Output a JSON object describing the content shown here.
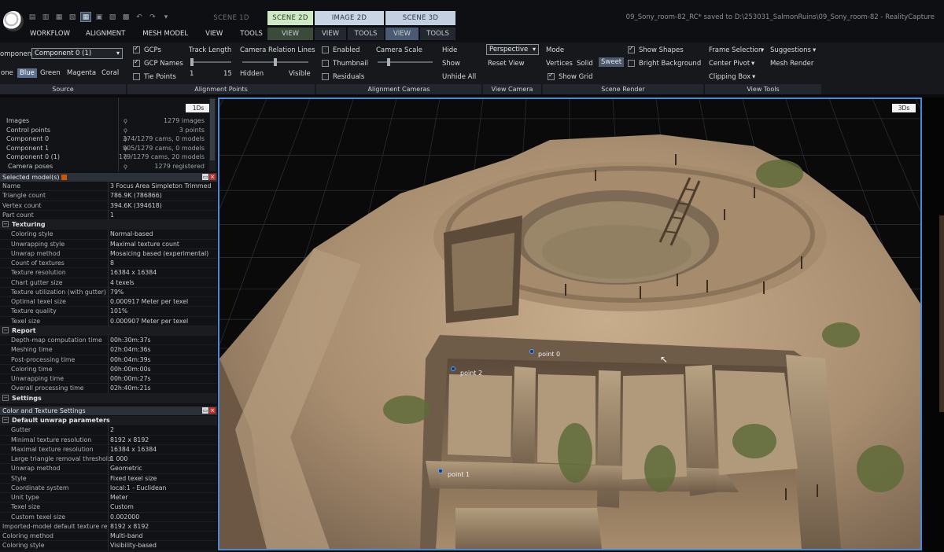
{
  "title_bar": {
    "scene_tabs": [
      "SCENE 1D",
      "SCENE 2D",
      "IMAGE 2D",
      "SCENE 3D"
    ],
    "sub_tabs": {
      "scene2d_view": "VIEW",
      "image_view": "VIEW",
      "image_tools": "TOOLS",
      "scene3d_view": "VIEW",
      "scene3d_tools": "TOOLS"
    },
    "menu": [
      "WORKFLOW",
      "ALIGNMENT",
      "MESH MODEL",
      "VIEW",
      "TOOLS"
    ],
    "status": "09_Sony_room-82_RC* saved to D:\\253031_SalmonRuins\\09_Sony_room-82 - RealityCapture"
  },
  "ribbon": {
    "source": {
      "component_label": "omponent",
      "component_value": "Component 0 (1)",
      "colors": [
        "one",
        "Blue",
        "Green",
        "Magenta",
        "Coral"
      ],
      "selected_color": "Blue",
      "group_label": "Source"
    },
    "alignment_points": {
      "gcps": "GCPs",
      "gcp_names": "GCP Names",
      "tie_points": "Tie Points",
      "track_length": "Track Length",
      "track_min": "1",
      "track_max": "15",
      "camera_relation_lines": "Camera Relation Lines",
      "hidden": "Hidden",
      "visible": "Visible",
      "group_label": "Alignment Points"
    },
    "alignment_cameras": {
      "enabled": "Enabled",
      "thumbnail": "Thumbnail",
      "residuals": "Residuals",
      "camera_scale": "Camera Scale",
      "hide": "Hide",
      "show": "Show",
      "unhide_all": "Unhide All",
      "group_label": "Alignment Cameras"
    },
    "view_camera": {
      "projection": "Perspective",
      "reset_view": "Reset View",
      "group_label": "View Camera"
    },
    "scene_render": {
      "mode": "Mode",
      "vertices": "Vertices",
      "solid": "Solid",
      "sweet": "Sweet",
      "show_shapes": "Show Shapes",
      "bright_background": "Bright Background",
      "show_grid": "Show Grid",
      "group_label": "Scene Render"
    },
    "view_tools": {
      "frame_selection": "Frame Selection",
      "suggestions": "Suggestions",
      "center_pivot": "Center Pivot",
      "mesh_render": "Mesh Render",
      "clipping_box": "Clipping Box",
      "group_label": "View Tools"
    }
  },
  "project_tree": {
    "tag": "1Ds",
    "rows": [
      {
        "name": "Images",
        "value": "1279 images"
      },
      {
        "name": "Control points",
        "value": "3 points"
      },
      {
        "name": "Component 0",
        "value": "374/1279 cams, 0 models"
      },
      {
        "name": "Component 1",
        "value": "905/1279 cams, 0 models"
      },
      {
        "name": "Component 0 (1)",
        "value": "179/1279 cams, 20 models"
      },
      {
        "name": "Camera poses",
        "value": "1279 registered"
      }
    ]
  },
  "selected_models": {
    "title": "Selected model(s)",
    "rows": [
      {
        "k": "Name",
        "v": "3 Focus Area Simpleton Trimmed"
      },
      {
        "k": "Triangle count",
        "v": "786.9K (786866)"
      },
      {
        "k": "Vertex count",
        "v": "394.6K (394618)"
      },
      {
        "k": "Part count",
        "v": "1"
      }
    ],
    "texturing_label": "Texturing",
    "texturing": [
      {
        "k": "Coloring style",
        "v": "Normal-based"
      },
      {
        "k": "Unwrapping style",
        "v": "Maximal texture count"
      },
      {
        "k": "Unwrap method",
        "v": "Mosaicing based (experimental)"
      },
      {
        "k": "Count of textures",
        "v": "8"
      },
      {
        "k": "Texture resolution",
        "v": "16384 x 16384"
      },
      {
        "k": "Chart gutter size",
        "v": "4 texels"
      },
      {
        "k": "Texture utilization (with gutter)",
        "v": "79%"
      },
      {
        "k": "Optimal texel size",
        "v": "0.000917 Meter per texel"
      },
      {
        "k": "Texture quality",
        "v": "101%"
      },
      {
        "k": "Texel size",
        "v": "0.000907 Meter per texel"
      }
    ],
    "report_label": "Report",
    "report": [
      {
        "k": "Depth-map computation time",
        "v": "00h:30m:37s"
      },
      {
        "k": "Meshing time",
        "v": "02h:04m:36s"
      },
      {
        "k": "Post-processing time",
        "v": "00h:04m:39s"
      },
      {
        "k": "Coloring time",
        "v": "00h:00m:00s"
      },
      {
        "k": "Unwrapping time",
        "v": "00h:00m:27s"
      },
      {
        "k": "Overall processing time",
        "v": "02h:40m:21s"
      }
    ],
    "settings_label": "Settings"
  },
  "color_texture_settings": {
    "title": "Color and Texture Settings",
    "section_label": "Default unwrap parameters",
    "rows": [
      {
        "k": "Gutter",
        "v": "2"
      },
      {
        "k": "Minimal texture resolution",
        "v": "8192 x 8192"
      },
      {
        "k": "Maximal texture resolution",
        "v": "16384 x 16384"
      },
      {
        "k": "Large triangle removal threshold",
        "v": "1 000"
      },
      {
        "k": "Unwrap method",
        "v": "Geometric"
      },
      {
        "k": "Style",
        "v": "Fixed texel size"
      },
      {
        "k": "Coordinate system",
        "v": "local:1 - Euclidean"
      },
      {
        "k": "Unit type",
        "v": "Meter"
      },
      {
        "k": "Texel size",
        "v": "Custom"
      },
      {
        "k": "Custom texel size",
        "v": "0.002000"
      }
    ],
    "tail_rows": [
      {
        "k": "Imported-model default texture res...",
        "v": "8192 x 8192"
      },
      {
        "k": "Coloring method",
        "v": "Multi-band"
      },
      {
        "k": "Coloring style",
        "v": "Visibility-based"
      }
    ]
  },
  "viewport": {
    "tag": "3Ds",
    "points": [
      "point 0",
      "point 2",
      "point 1"
    ]
  },
  "colors": {
    "accent": "#4a88d8",
    "scene2d": "#cfe8c6",
    "image2d": "#c9d4e4",
    "scene3d": "#c3d0e2"
  }
}
